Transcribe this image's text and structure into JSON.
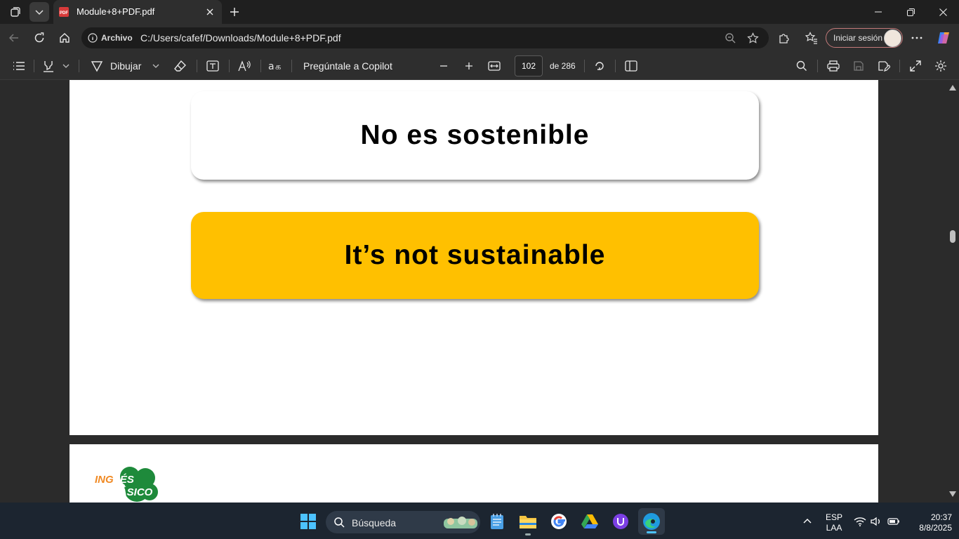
{
  "browser": {
    "tab_title": "Module+8+PDF.pdf",
    "address_label": "Archivo",
    "url": "C:/Users/cafef/Downloads/Module+8+PDF.pdf",
    "signin_label": "Iniciar sesión"
  },
  "pdf_toolbar": {
    "draw_label": "Dibujar",
    "copilot_label": "Pregúntale a Copilot",
    "page_current": "102",
    "page_total": "de 286"
  },
  "page": {
    "spanish_text": "No es sostenible",
    "english_text": "It’s not sustainable",
    "logo_line1_a": "ING",
    "logo_line1_b": "LÉS",
    "logo_line2": "BÁSICO",
    "colors": {
      "highlight_box": "#ffc000",
      "logo_green": "#1e8a3b",
      "logo_orange": "#f08a24"
    }
  },
  "taskbar": {
    "search_placeholder": "Búsqueda",
    "lang_line1": "ESP",
    "lang_line2": "LAA",
    "time": "20:37",
    "date": "8/8/2025"
  }
}
